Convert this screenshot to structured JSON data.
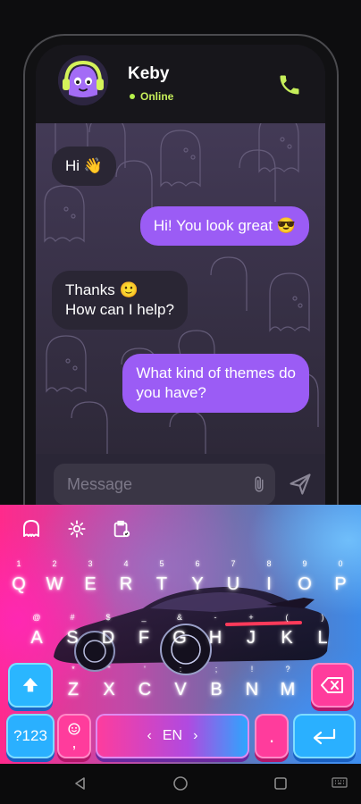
{
  "header": {
    "contact_name": "Keby",
    "status": "Online"
  },
  "messages": [
    {
      "text": "Hi 👋",
      "direction": "in"
    },
    {
      "text": "Hi! You look great 😎",
      "direction": "out"
    },
    {
      "line1": "Thanks 🙂",
      "line2": "How can I help?",
      "direction": "in"
    },
    {
      "line1": "What kind of themes do",
      "line2": "you have?",
      "direction": "out"
    }
  ],
  "composer": {
    "placeholder": "Message"
  },
  "keyboard": {
    "row1": [
      {
        "k": "Q",
        "h": "1"
      },
      {
        "k": "W",
        "h": "2"
      },
      {
        "k": "E",
        "h": "3"
      },
      {
        "k": "R",
        "h": "4"
      },
      {
        "k": "T",
        "h": "5"
      },
      {
        "k": "Y",
        "h": "6"
      },
      {
        "k": "U",
        "h": "7"
      },
      {
        "k": "I",
        "h": "8"
      },
      {
        "k": "O",
        "h": "9"
      },
      {
        "k": "P",
        "h": "0"
      }
    ],
    "row2": [
      {
        "k": "A",
        "h": "@"
      },
      {
        "k": "S",
        "h": "#"
      },
      {
        "k": "D",
        "h": "$"
      },
      {
        "k": "F",
        "h": "_"
      },
      {
        "k": "G",
        "h": "&"
      },
      {
        "k": "H",
        "h": "-"
      },
      {
        "k": "J",
        "h": "+"
      },
      {
        "k": "K",
        "h": "("
      },
      {
        "k": "L",
        "h": ")"
      }
    ],
    "row3": [
      {
        "k": "Z",
        "h": "*"
      },
      {
        "k": "X",
        "h": "\""
      },
      {
        "k": "C",
        "h": "'"
      },
      {
        "k": "V",
        "h": ":"
      },
      {
        "k": "B",
        "h": ";"
      },
      {
        "k": "N",
        "h": "!"
      },
      {
        "k": "M",
        "h": "?"
      }
    ],
    "num_label": "?123",
    "comma_label": ",",
    "space_label": "EN",
    "space_left": "‹",
    "space_right": "›",
    "period_label": "."
  },
  "colors": {
    "accent_purple": "#9b5cf5",
    "online_green": "#c6ee5a",
    "call_icon": "#c6ee5a"
  }
}
